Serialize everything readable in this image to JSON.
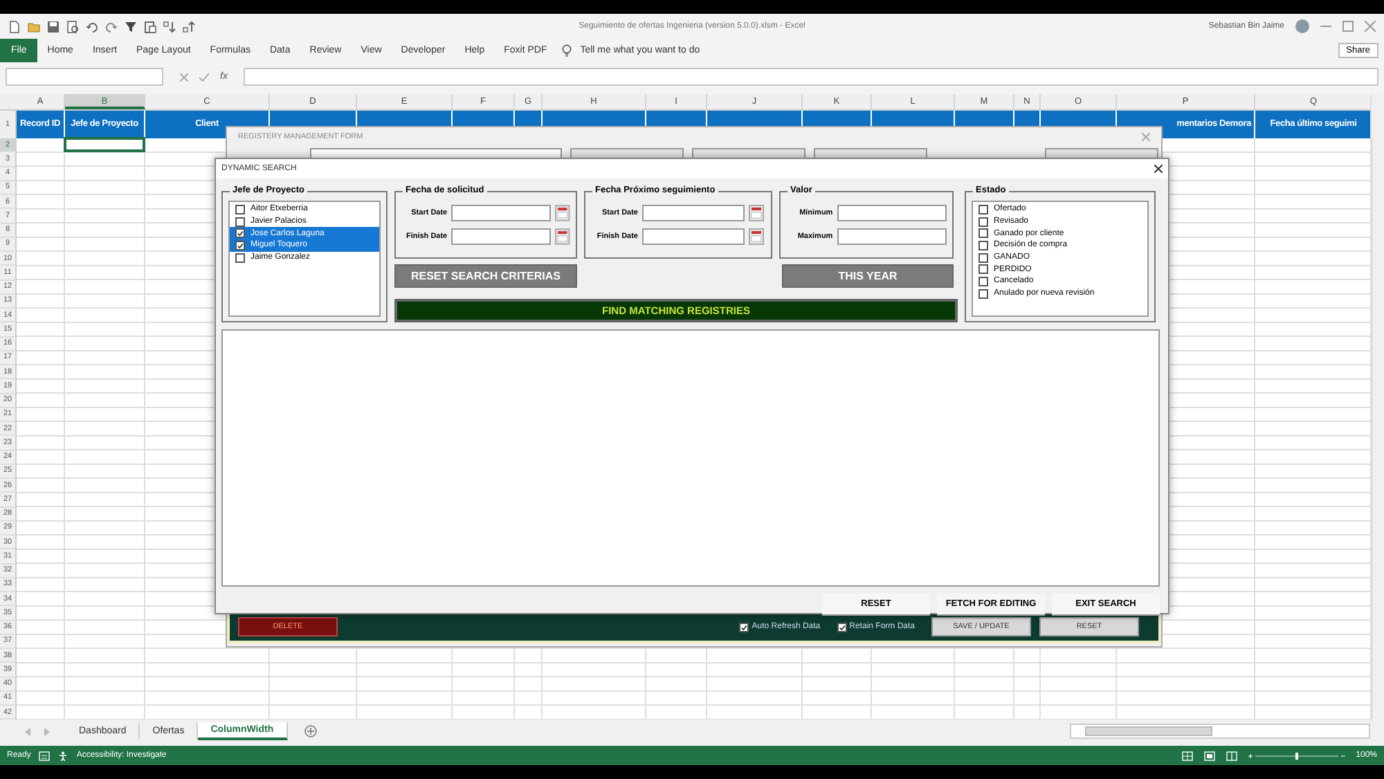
{
  "app_title": "Seguimiento de ofertas Ingenieria (version 5.0.0).xlsm - Excel",
  "user": "Sebastian Bin Jaime",
  "file_tab": "File",
  "ribbon_tabs": [
    "Home",
    "Insert",
    "Page Layout",
    "Formulas",
    "Data",
    "Review",
    "View",
    "Developer",
    "Help",
    "Foxit PDF"
  ],
  "tell_me": "Tell me what you want to do",
  "share": "Share",
  "fx": "fx",
  "columns": [
    {
      "label": "A",
      "selected": false,
      "header": "Record ID"
    },
    {
      "label": "B",
      "selected": true,
      "header": "Jefe de Proyecto"
    },
    {
      "label": "C",
      "selected": false,
      "header": "Client"
    },
    {
      "label": "D",
      "selected": false
    },
    {
      "label": "E",
      "selected": false
    },
    {
      "label": "F",
      "selected": false
    },
    {
      "label": "G",
      "selected": false
    },
    {
      "label": "H",
      "selected": false
    },
    {
      "label": "I",
      "selected": false
    },
    {
      "label": "J",
      "selected": false
    },
    {
      "label": "K",
      "selected": false
    },
    {
      "label": "L",
      "selected": false
    },
    {
      "label": "M",
      "selected": false
    },
    {
      "label": "N",
      "selected": false
    },
    {
      "label": "O",
      "selected": false
    },
    {
      "label": "P",
      "selected": false,
      "header": "mentarios Demora"
    },
    {
      "label": "Q",
      "selected": false,
      "header": "Fecha último seguimi"
    }
  ],
  "rows": [
    {
      "label": "1",
      "selected": false
    },
    {
      "label": "2",
      "selected": true
    },
    {
      "label": "3",
      "selected": false
    },
    {
      "label": "4",
      "selected": false
    },
    {
      "label": "5",
      "selected": false
    },
    {
      "label": "6",
      "selected": false
    },
    {
      "label": "7",
      "selected": false
    },
    {
      "label": "8",
      "selected": false
    },
    {
      "label": "9",
      "selected": false
    },
    {
      "label": "10",
      "selected": false
    },
    {
      "label": "11",
      "selected": false
    },
    {
      "label": "12",
      "selected": false
    },
    {
      "label": "13",
      "selected": false
    },
    {
      "label": "14",
      "selected": false
    },
    {
      "label": "15",
      "selected": false
    },
    {
      "label": "16",
      "selected": false
    },
    {
      "label": "17",
      "selected": false
    },
    {
      "label": "18",
      "selected": false
    },
    {
      "label": "19",
      "selected": false
    },
    {
      "label": "20",
      "selected": false
    },
    {
      "label": "21",
      "selected": false
    },
    {
      "label": "22",
      "selected": false
    },
    {
      "label": "23",
      "selected": false
    },
    {
      "label": "24",
      "selected": false
    },
    {
      "label": "25",
      "selected": false
    },
    {
      "label": "26",
      "selected": false
    },
    {
      "label": "27",
      "selected": false
    },
    {
      "label": "28",
      "selected": false
    },
    {
      "label": "29",
      "selected": false
    },
    {
      "label": "30",
      "selected": false
    },
    {
      "label": "31",
      "selected": false
    },
    {
      "label": "32",
      "selected": false
    },
    {
      "label": "33",
      "selected": false
    },
    {
      "label": "34",
      "selected": false
    },
    {
      "label": "35",
      "selected": false
    },
    {
      "label": "36",
      "selected": false
    },
    {
      "label": "37",
      "selected": false
    },
    {
      "label": "38",
      "selected": false
    },
    {
      "label": "39",
      "selected": false
    },
    {
      "label": "40",
      "selected": false
    },
    {
      "label": "41",
      "selected": false
    },
    {
      "label": "42",
      "selected": false
    }
  ],
  "sheet_tabs": [
    {
      "label": "Dashboard",
      "selected": false
    },
    {
      "label": "Ofertas",
      "selected": false
    },
    {
      "label": "ColumnWidth",
      "selected": true
    }
  ],
  "status": {
    "ready": "Ready",
    "accessibility": "Accessibility: Investigate",
    "zoom": "100%",
    "zoom_slider": {
      "level": 0.5
    }
  },
  "registry_form": {
    "title": "REGISTERY MANAGEMENT FORM",
    "delete": "DELETE",
    "auto_refresh": {
      "label": "Auto Refresh Data",
      "checked": true
    },
    "retain": {
      "label": "Retain Form Data",
      "checked": true
    },
    "save": "SAVE / UPDATE",
    "reset": "RESET"
  },
  "dynamic_search": {
    "title": "DYNAMIC SEARCH",
    "managers": {
      "title": "Jefe de Proyecto",
      "items": [
        {
          "label": "Aitor Etxeberria",
          "checked": false,
          "selected": false
        },
        {
          "label": "Javier Palacios",
          "checked": false,
          "selected": false
        },
        {
          "label": "Jose Carlos Laguna",
          "checked": true,
          "selected": true
        },
        {
          "label": "Miguel Toquero",
          "checked": true,
          "selected": true
        },
        {
          "label": "Jaime Gonzalez",
          "checked": false,
          "selected": false
        }
      ]
    },
    "request_date": {
      "title": "Fecha de solicitud",
      "start": "Start Date",
      "finish": "Finish Date"
    },
    "next_date": {
      "title": "Fecha Próximo seguimiento",
      "start": "Start Date",
      "finish": "Finish Date"
    },
    "value": {
      "title": "Valor",
      "min": "Minimum",
      "max": "Maximum"
    },
    "status": {
      "title": "Estado",
      "items": [
        {
          "label": "Ofertado",
          "checked": false
        },
        {
          "label": "Revisado",
          "checked": false
        },
        {
          "label": "Ganado por cliente",
          "checked": false
        },
        {
          "label": "Decisión de compra",
          "checked": false
        },
        {
          "label": "GANADO",
          "checked": false
        },
        {
          "label": "PERDIDO",
          "checked": false
        },
        {
          "label": "Cancelado",
          "checked": false
        },
        {
          "label": "Anulado por nueva revisión",
          "checked": false
        }
      ]
    },
    "reset_criteria": "RESET SEARCH CRITERIAS",
    "this_year": "THIS YEAR",
    "find": "FIND MATCHING REGISTRIES",
    "footer_buttons": [
      "RESET",
      "FETCH FOR EDITING",
      "EXIT SEARCH"
    ]
  }
}
